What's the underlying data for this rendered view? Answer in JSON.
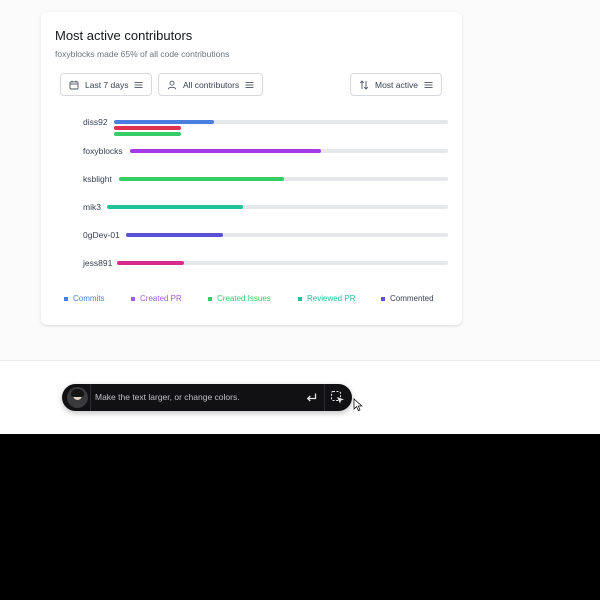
{
  "card": {
    "title": "Most active contributors",
    "subtitle": "foxyblocks made 65% of all code contributions"
  },
  "filters": {
    "range_label": "Last 7 days",
    "contributors_label": "All contributors",
    "sort_label": "Most active"
  },
  "contributors": [
    {
      "name": "diss92",
      "bars": [
        {
          "type": "Commits",
          "start": 0.0,
          "end": 0.3
        },
        {
          "type": "Pull request (red)",
          "start": 0.0,
          "end": 0.2
        },
        {
          "type": "Created Issues",
          "start": 0.0,
          "end": 0.2
        }
      ]
    },
    {
      "name": "foxyblocks",
      "bars": [
        {
          "type": "Created PR",
          "start": 0.0,
          "end": 0.6
        }
      ]
    },
    {
      "name": "ksblight",
      "bars": [
        {
          "type": "Created Issues",
          "start": 0.0,
          "end": 0.5
        }
      ]
    },
    {
      "name": "mik3",
      "bars": [
        {
          "type": "Reviewed PR",
          "start": 0.0,
          "end": 0.4
        }
      ]
    },
    {
      "name": "0gDev-01",
      "bars": [
        {
          "type": "Commented",
          "start": 0.0,
          "end": 0.3
        }
      ]
    },
    {
      "name": "jess891",
      "bars": [
        {
          "type": "pink",
          "start": 0.0,
          "end": 0.2
        }
      ]
    }
  ],
  "legend": [
    {
      "label": "Commits",
      "color": "#4a7fe0"
    },
    {
      "label": "Created PR",
      "color": "#a35be8"
    },
    {
      "label": "Created Issues",
      "color": "#33cc66"
    },
    {
      "label": "Reviewed PR",
      "color": "#22c0a0"
    },
    {
      "label": "Commented",
      "color": "#5955d6"
    }
  ],
  "colors": {
    "commits": "#4a7fe0",
    "red": "#e0314f",
    "green": "#33cc66",
    "purple": "#a33be8",
    "teal": "#22c39a",
    "indigo": "#5a52d6",
    "pink": "#d92b8b"
  },
  "command_bar": {
    "placeholder": "Make the text larger, or change colors."
  }
}
